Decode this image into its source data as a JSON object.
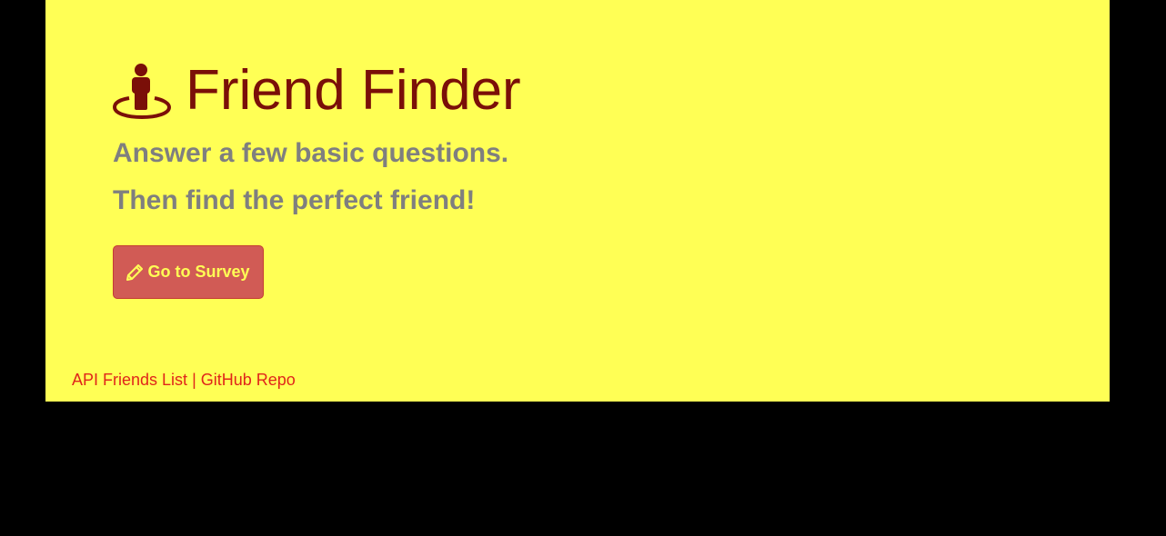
{
  "header": {
    "icon": "street-view-icon",
    "title": "Friend Finder",
    "subtitle_1": "Answer a few basic questions.",
    "subtitle_2": "Then find the perfect friend!"
  },
  "survey_button": {
    "icon": "pencil-icon",
    "label": "Go to Survey"
  },
  "footer": {
    "api_link": "API Friends List",
    "separator": "|",
    "github_link": "GitHub Repo"
  },
  "colors": {
    "background": "#ffff55",
    "title": "#7a0f08",
    "subtitle": "#7f7f7f",
    "button": "#d15b55",
    "button_text": "#ffff55",
    "links": "#e0251a"
  }
}
